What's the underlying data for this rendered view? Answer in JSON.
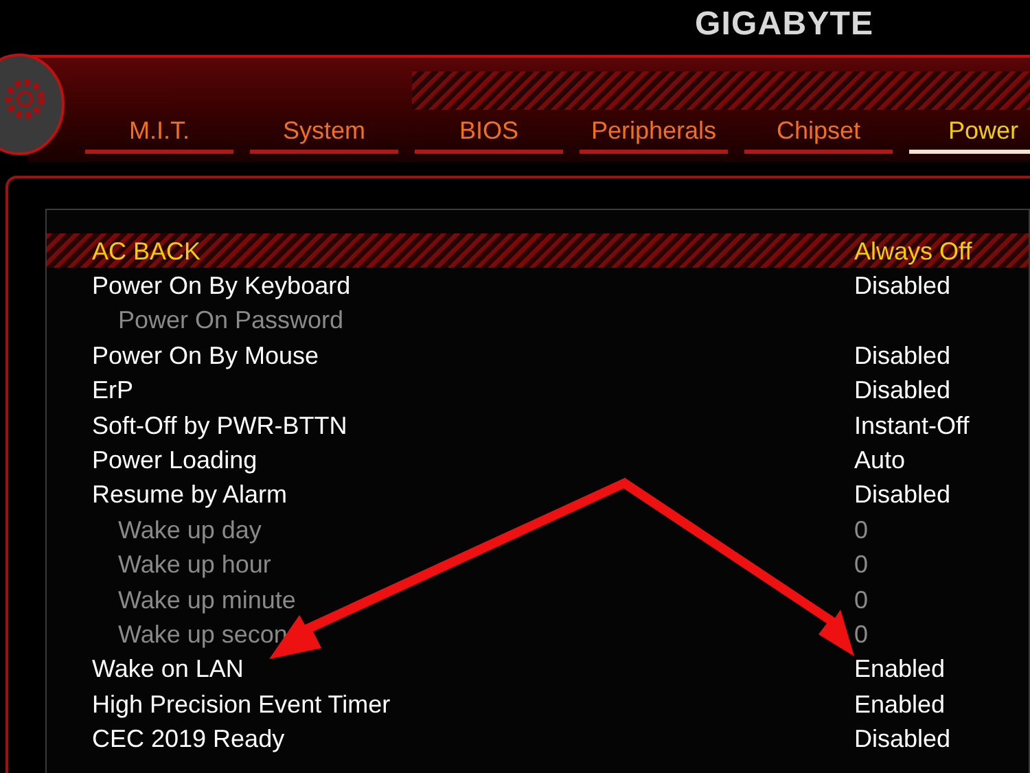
{
  "brand": "GIGABYTE",
  "tabs": [
    {
      "label": "M.I.T.",
      "selected": false
    },
    {
      "label": "System",
      "selected": false
    },
    {
      "label": "BIOS",
      "selected": false
    },
    {
      "label": "Peripherals",
      "selected": false
    },
    {
      "label": "Chipset",
      "selected": false
    },
    {
      "label": "Power",
      "selected": true
    }
  ],
  "settings": [
    {
      "label": "AC BACK",
      "value": "Always Off",
      "selected": true,
      "disabled": false
    },
    {
      "label": "Power On By Keyboard",
      "value": "Disabled",
      "selected": false,
      "disabled": false
    },
    {
      "label": "Power On Password",
      "selected": false,
      "disabled": true
    },
    {
      "label": "Power On By Mouse",
      "value": "Disabled",
      "selected": false,
      "disabled": false
    },
    {
      "label": "ErP",
      "value": "Disabled",
      "selected": false,
      "disabled": false
    },
    {
      "label": "Soft-Off by PWR-BTTN",
      "value": "Instant-Off",
      "selected": false,
      "disabled": false
    },
    {
      "label": "Power Loading",
      "value": "Auto",
      "selected": false,
      "disabled": false
    },
    {
      "label": "Resume by Alarm",
      "value": "Disabled",
      "selected": false,
      "disabled": false
    },
    {
      "label": "Wake up day",
      "value": "0",
      "selected": false,
      "disabled": true
    },
    {
      "label": "Wake up hour",
      "value": "0",
      "selected": false,
      "disabled": true
    },
    {
      "label": "Wake up minute",
      "value": "0",
      "selected": false,
      "disabled": true
    },
    {
      "label": "Wake up secon",
      "value": "0",
      "selected": false,
      "disabled": true
    },
    {
      "label": "Wake on LAN",
      "value": "Enabled",
      "selected": false,
      "disabled": false
    },
    {
      "label": "High Precision Event Timer",
      "value": "Enabled",
      "selected": false,
      "disabled": false
    },
    {
      "label": "CEC 2019 Ready",
      "value": "Disabled",
      "selected": false,
      "disabled": false
    }
  ]
}
